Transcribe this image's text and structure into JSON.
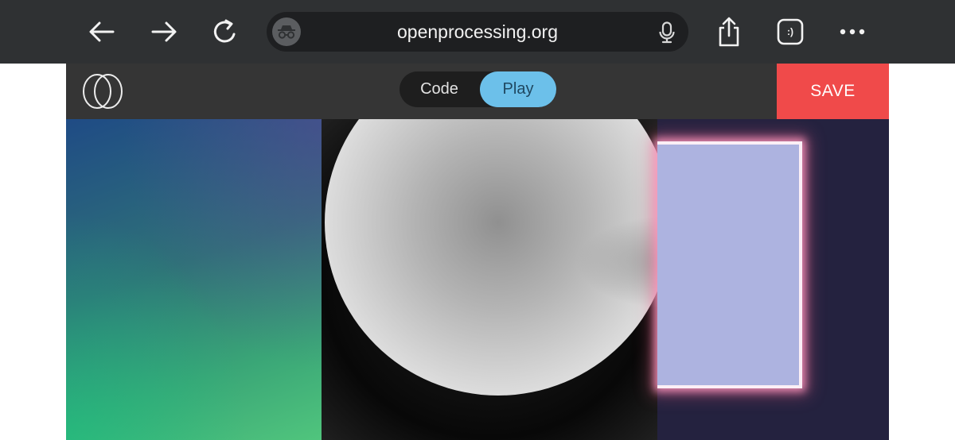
{
  "browser": {
    "url": "openprocessing.org",
    "icons": {
      "back": "arrow-left-icon",
      "forward": "arrow-right-icon",
      "reload": "reload-icon",
      "privacy": "private-browsing-icon",
      "mic": "microphone-icon",
      "share": "share-icon",
      "tabs": "tab-overview-icon",
      "more": "more-icon"
    },
    "tabs_badge": ":)"
  },
  "header": {
    "logo": "openprocessing-logo",
    "toggle": {
      "code_label": "Code",
      "play_label": "Play",
      "selected": "Play"
    },
    "save_label": "SAVE"
  },
  "colors": {
    "browser_bar": "#2f3133",
    "header": "#353535",
    "play_active": "#6cc0ea",
    "save": "#f04a4a",
    "canvas_bg": "#24223f",
    "rect_fill": "#adb3e0"
  }
}
